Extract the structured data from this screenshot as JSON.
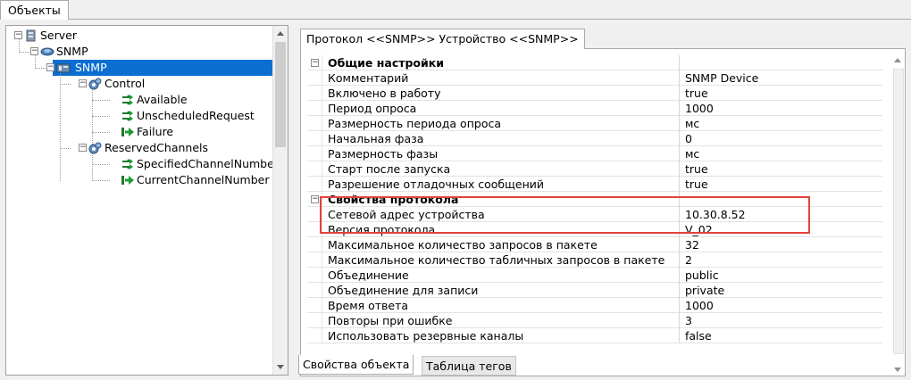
{
  "top_tab": "Объекты",
  "tree": [
    {
      "label": "Server",
      "level": 0,
      "icon": "server-icon"
    },
    {
      "label": "SNMP",
      "level": 1,
      "icon": "network-icon"
    },
    {
      "label": "SNMP",
      "level": 2,
      "icon": "device-icon",
      "selected": true
    },
    {
      "label": "Control",
      "level": 3,
      "icon": "channel-group-icon"
    },
    {
      "label": "Available",
      "level": 4,
      "icon": "tag-icon"
    },
    {
      "label": "UnscheduledRequest",
      "level": 4,
      "icon": "tag-icon"
    },
    {
      "label": "Failure",
      "level": 4,
      "icon": "tag-arrow-icon"
    },
    {
      "label": "ReservedChannels",
      "level": 3,
      "icon": "channel-group-icon"
    },
    {
      "label": "SpecifiedChannelNumber",
      "level": 4,
      "icon": "tag-icon"
    },
    {
      "label": "CurrentChannelNumber",
      "level": 4,
      "icon": "tag-arrow-icon"
    }
  ],
  "doc_tab": "Протокол <<SNMP>> Устройство <<SNMP>>",
  "properties": [
    {
      "name": "Общие настройки",
      "value": "",
      "category": true
    },
    {
      "name": "Комментарий",
      "value": "SNMP Device"
    },
    {
      "name": "Включено в работу",
      "value": "true"
    },
    {
      "name": "Период опроса",
      "value": "1000"
    },
    {
      "name": "Размерность периода опроса",
      "value": "мс"
    },
    {
      "name": "Начальная фаза",
      "value": "0"
    },
    {
      "name": "Размерность фазы",
      "value": "мс"
    },
    {
      "name": "Старт после запуска",
      "value": "true"
    },
    {
      "name": "Разрешение отладочных сообщений",
      "value": "true"
    },
    {
      "name": "Свойства протокола",
      "value": "",
      "category": true
    },
    {
      "name": "Сетевой адрес устройства",
      "value": "10.30.8.52"
    },
    {
      "name": "Версия протокола",
      "value": "V_02"
    },
    {
      "name": "Максимальное количество запросов в пакете",
      "value": "32"
    },
    {
      "name": "Максимальное количество табличных запросов в пакете",
      "value": "2"
    },
    {
      "name": "Объединение",
      "value": "public"
    },
    {
      "name": "Объединение для записи",
      "value": "private"
    },
    {
      "name": "Время ответа",
      "value": "1000"
    },
    {
      "name": "Повторы при ошибке",
      "value": "3"
    },
    {
      "name": "Использовать резервные каналы",
      "value": "false"
    }
  ],
  "bottom_tabs": [
    "Свойства объекта",
    "Таблица тегов"
  ],
  "colors": {
    "selection": "#0a6fd1",
    "highlight_box": "#e4413d"
  }
}
